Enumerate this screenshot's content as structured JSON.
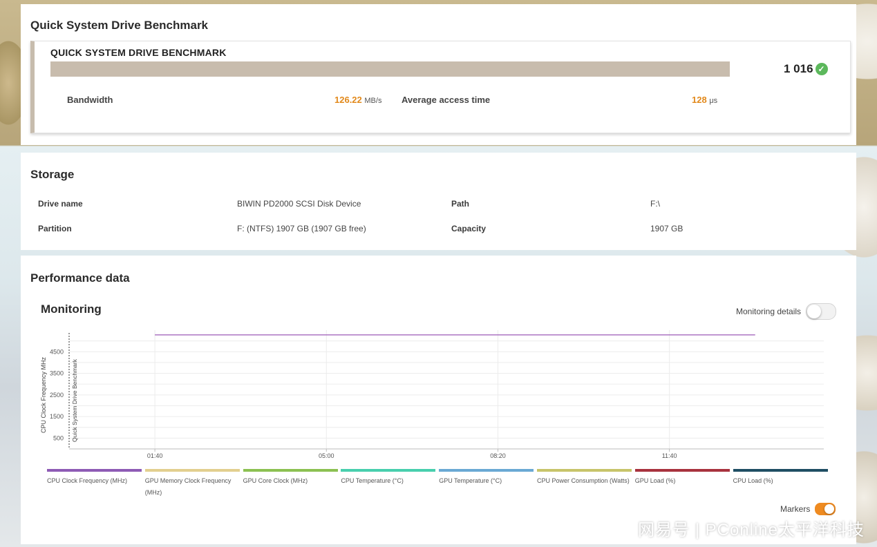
{
  "benchmark_panel": {
    "title": "Quick System Drive Benchmark",
    "heading": "QUICK SYSTEM DRIVE BENCHMARK",
    "score": "1 016",
    "bandwidth_label": "Bandwidth",
    "bandwidth_value": "126.22",
    "bandwidth_unit": "MB/s",
    "access_label": "Average access time",
    "access_value": "128",
    "access_unit": "μs"
  },
  "storage": {
    "title": "Storage",
    "drive_name_label": "Drive name",
    "drive_name_value": "BIWIN PD2000 SCSI Disk Device",
    "path_label": "Path",
    "path_value": "F:\\",
    "partition_label": "Partition",
    "partition_value": "F: (NTFS) 1907 GB (1907 GB free)",
    "capacity_label": "Capacity",
    "capacity_value": "1907 GB"
  },
  "performance": {
    "title": "Performance data",
    "monitoring_title": "Monitoring",
    "details_toggle_label": "Monitoring details",
    "markers_toggle_label": "Markers",
    "colors": {
      "accent": "#ef8b21",
      "bar": "#c8bcad",
      "success": "#5cb85c"
    }
  },
  "chart_data": {
    "type": "line",
    "ylabel": "CPU Clock Frequency MHz",
    "marker_label": "Quick System Drive Benchmark",
    "yticks": [
      500,
      1500,
      2500,
      3500,
      4500
    ],
    "ylim": [
      0,
      5500
    ],
    "xticks": [
      "01:40",
      "05:00",
      "08:20",
      "11:40"
    ],
    "x_seconds": [
      100,
      800
    ],
    "xlim_seconds": [
      0,
      880
    ],
    "series": [
      {
        "name": "CPU Clock Frequency (MHz)",
        "color": "#9b59b6",
        "values": [
          5280,
          5280
        ]
      }
    ],
    "legend": [
      {
        "name": "CPU Clock Frequency (MHz)",
        "color": "#8e5bb5"
      },
      {
        "name": "GPU Memory Clock Frequency (MHz)",
        "color": "#e2cf8f"
      },
      {
        "name": "GPU Core Clock (MHz)",
        "color": "#8cc152"
      },
      {
        "name": "CPU Temperature (°C)",
        "color": "#48cfad"
      },
      {
        "name": "GPU Temperature (°C)",
        "color": "#6aa9d4"
      },
      {
        "name": "CPU Power Consumption (Watts)",
        "color": "#c7c46a"
      },
      {
        "name": "GPU Load (%)",
        "color": "#a8323e"
      },
      {
        "name": "CPU Load (%)",
        "color": "#1f4e63"
      }
    ]
  },
  "watermark": "网易号 | PConline太平洋科技"
}
